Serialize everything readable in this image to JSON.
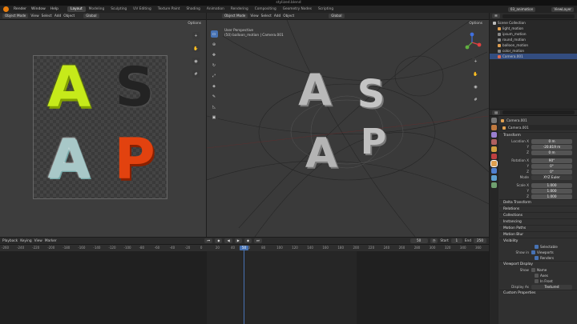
{
  "app": {
    "title": "stylized.blend",
    "menu": [
      "Render",
      "Window",
      "Help"
    ],
    "workspaces": [
      "Layout",
      "Modeling",
      "Sculpting",
      "UV Editing",
      "Texture Paint",
      "Shading",
      "Animation",
      "Rendering",
      "Compositing",
      "Geometry Nodes",
      "Scripting"
    ],
    "active_workspace": "Layout",
    "scene": "03_animation",
    "view_layer": "ViewLayer"
  },
  "left_viewport": {
    "mode": "Object Mode",
    "menus": [
      "View",
      "Select",
      "Add",
      "Object"
    ],
    "orientation": "Global",
    "options": "Options",
    "letters": [
      {
        "char": "A",
        "color": "#c6ea1a"
      },
      {
        "char": "S",
        "color": "#232323"
      },
      {
        "char": "A",
        "color": "#a8c8c8"
      },
      {
        "char": "P",
        "color": "#e2420f"
      }
    ]
  },
  "main_viewport": {
    "mode": "Object Mode",
    "menus": [
      "View",
      "Select",
      "Add",
      "Object"
    ],
    "orientation": "Global",
    "options": "Options",
    "view_name": "User Perspective",
    "collection_info": "(50) balloon_motion | Camera.001",
    "letters": [
      {
        "char": "A"
      },
      {
        "char": "S"
      },
      {
        "char": "A"
      },
      {
        "char": "P"
      }
    ],
    "tools": [
      "select",
      "cursor",
      "move",
      "rotate",
      "scale",
      "transform",
      "annotate",
      "measure",
      "add-cube"
    ]
  },
  "outliner": {
    "header": "Scene Collection",
    "items": [
      {
        "name": "Scene Collection",
        "color": "#bbbbbb"
      },
      {
        "name": "light_motion",
        "color": "#e0a050"
      },
      {
        "name": "ipsum_motion",
        "color": "#888888"
      },
      {
        "name": "round_motion",
        "color": "#888888"
      },
      {
        "name": "balloon_motion",
        "color": "#e0a050"
      },
      {
        "name": "color_motion",
        "color": "#888888"
      },
      {
        "name": "Camera.001",
        "color": "#e06a50"
      }
    ]
  },
  "properties": {
    "object_name": "Camera.001",
    "object_name_sub": "Camera.001",
    "sections": {
      "transform": "Transform",
      "delta": "Delta Transform",
      "relations": "Relations",
      "collections": "Collections",
      "instancing": "Instancing",
      "motion_paths": "Motion Paths",
      "motion_blur": "Motion Blur",
      "visibility": "Visibility",
      "viewport_display": "Viewport Display",
      "custom_props": "Custom Properties"
    },
    "location": {
      "label": "Location X",
      "x": "0 m",
      "y": "-20.819 m",
      "z": "0 m"
    },
    "rotation": {
      "label": "Rotation X",
      "x": "90°",
      "y": "0°",
      "z": "0°"
    },
    "mode": {
      "label": "Mode",
      "value": "XYZ Euler"
    },
    "scale": {
      "label": "Scale X",
      "x": "1.000",
      "y": "1.000",
      "z": "1.000"
    },
    "axis": {
      "y": "Y",
      "z": "Z"
    },
    "visibility": {
      "selectable": "Selectable",
      "show_in": "Show in",
      "viewports": "Viewports",
      "renders": "Renders"
    },
    "display": {
      "show": "Show",
      "name": "Name",
      "axes": "Axes",
      "in_front": "In Front",
      "display_as": "Display As",
      "display_as_value": "Textured"
    }
  },
  "timeline": {
    "menus": [
      "Playback",
      "Keying",
      "View",
      "Marker"
    ],
    "current_frame": "50",
    "start_label": "Start",
    "start": "1",
    "end_label": "End",
    "end": "250",
    "ticks": [
      "-260",
      "-240",
      "-220",
      "-200",
      "-180",
      "-160",
      "-140",
      "-120",
      "-100",
      "-80",
      "-60",
      "-40",
      "-20",
      "0",
      "20",
      "40",
      "60",
      "80",
      "100",
      "120",
      "140",
      "160",
      "180",
      "200",
      "220",
      "240",
      "260",
      "280",
      "300",
      "320",
      "340",
      "360"
    ]
  }
}
